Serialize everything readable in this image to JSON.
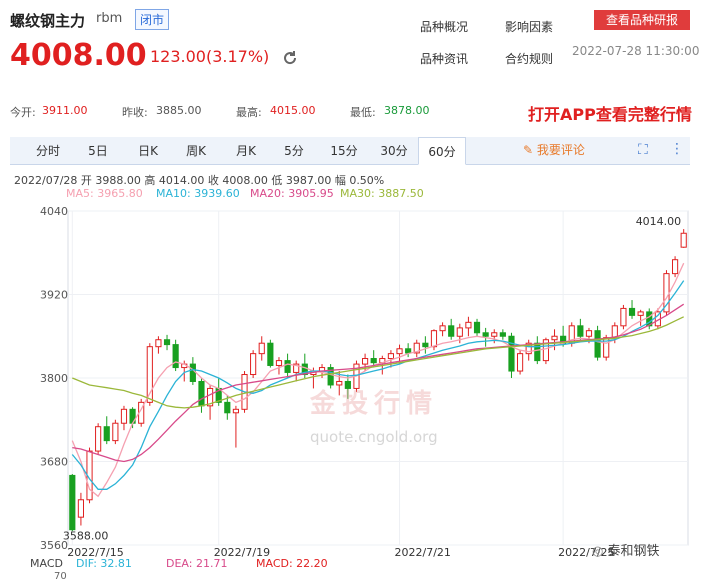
{
  "header": {
    "title": "螺纹钢主力",
    "symbol": "rbm",
    "status_badge": "闭市",
    "price": "4008.00",
    "change": "123.00(3.17%)",
    "links": [
      "品种概况",
      "影响因素",
      "品种资讯",
      "合约规则"
    ],
    "research_button": "查看品种研报",
    "timestamp": "2022-07-28 11:30:00"
  },
  "stats": {
    "open_label": "今开:",
    "open": "3911.00",
    "prev_label": "昨收:",
    "prev": "3885.00",
    "high_label": "最高:",
    "high": "4015.00",
    "low_label": "最低:",
    "low": "3878.00",
    "app_banner": "打开APP查看完整行情"
  },
  "tabs": [
    "分时",
    "5日",
    "日K",
    "周K",
    "月K",
    "5分",
    "15分",
    "30分",
    "60分"
  ],
  "active_tab": "60分",
  "comment_label": "我要评论",
  "candle_info": "2022/07/28  开 3988.00  高 4014.00  收 4008.00  低 3987.00  幅 0.50%",
  "ma": {
    "ma5": "MA5: 3965.80",
    "ma10": "MA10: 3939.60",
    "ma20": "MA20: 3905.95",
    "ma30": "MA30: 3887.50"
  },
  "macd": {
    "label": "MACD",
    "dif": "DIF: 32.81",
    "dea": "DEA: 21.71",
    "macd": "MACD: 22.20",
    "axis_top": "70"
  },
  "watermark": {
    "cn": "金投行情",
    "url": "quote.cngold.org"
  },
  "wechat": "泰和钢铁",
  "chart_data": {
    "type": "candlestick",
    "y_ticks": [
      4040,
      3920,
      3800,
      3680,
      3560
    ],
    "ylim": [
      3560,
      4040
    ],
    "x_labels": [
      "2022/7/15",
      "2022/7/19",
      "2022/7/21",
      "2022/7/25"
    ],
    "max_label": "4014.00",
    "min_label": "3588.00",
    "candles": [
      [
        3660,
        3662,
        3580,
        3582
      ],
      [
        3600,
        3635,
        3588,
        3625
      ],
      [
        3625,
        3700,
        3620,
        3695
      ],
      [
        3695,
        3735,
        3690,
        3730
      ],
      [
        3730,
        3745,
        3705,
        3710
      ],
      [
        3710,
        3740,
        3705,
        3735
      ],
      [
        3735,
        3760,
        3725,
        3755
      ],
      [
        3755,
        3758,
        3728,
        3735
      ],
      [
        3735,
        3770,
        3730,
        3765
      ],
      [
        3765,
        3850,
        3760,
        3845
      ],
      [
        3845,
        3860,
        3835,
        3855
      ],
      [
        3855,
        3862,
        3840,
        3848
      ],
      [
        3848,
        3855,
        3810,
        3815
      ],
      [
        3815,
        3825,
        3795,
        3820
      ],
      [
        3820,
        3830,
        3790,
        3795
      ],
      [
        3795,
        3800,
        3750,
        3760
      ],
      [
        3760,
        3790,
        3740,
        3785
      ],
      [
        3785,
        3800,
        3760,
        3765
      ],
      [
        3765,
        3775,
        3740,
        3750
      ],
      [
        3750,
        3760,
        3700,
        3755
      ],
      [
        3755,
        3810,
        3750,
        3805
      ],
      [
        3805,
        3840,
        3800,
        3835
      ],
      [
        3835,
        3860,
        3825,
        3850
      ],
      [
        3850,
        3855,
        3815,
        3818
      ],
      [
        3818,
        3830,
        3805,
        3825
      ],
      [
        3825,
        3835,
        3800,
        3808
      ],
      [
        3808,
        3825,
        3795,
        3820
      ],
      [
        3820,
        3835,
        3800,
        3805
      ],
      [
        3805,
        3815,
        3785,
        3810
      ],
      [
        3810,
        3820,
        3800,
        3815
      ],
      [
        3815,
        3820,
        3785,
        3790
      ],
      [
        3790,
        3810,
        3775,
        3795
      ],
      [
        3795,
        3805,
        3770,
        3785
      ],
      [
        3785,
        3825,
        3780,
        3820
      ],
      [
        3820,
        3835,
        3810,
        3828
      ],
      [
        3828,
        3840,
        3815,
        3822
      ],
      [
        3822,
        3832,
        3805,
        3828
      ],
      [
        3828,
        3840,
        3815,
        3835
      ],
      [
        3835,
        3848,
        3820,
        3842
      ],
      [
        3842,
        3850,
        3830,
        3836
      ],
      [
        3836,
        3855,
        3830,
        3850
      ],
      [
        3850,
        3860,
        3835,
        3845
      ],
      [
        3845,
        3870,
        3840,
        3868
      ],
      [
        3868,
        3880,
        3860,
        3875
      ],
      [
        3875,
        3885,
        3855,
        3860
      ],
      [
        3860,
        3878,
        3850,
        3872
      ],
      [
        3872,
        3888,
        3860,
        3880
      ],
      [
        3880,
        3885,
        3860,
        3865
      ],
      [
        3865,
        3872,
        3845,
        3860
      ],
      [
        3860,
        3870,
        3850,
        3865
      ],
      [
        3865,
        3870,
        3855,
        3860
      ],
      [
        3860,
        3865,
        3800,
        3810
      ],
      [
        3810,
        3840,
        3805,
        3835
      ],
      [
        3835,
        3855,
        3825,
        3850
      ],
      [
        3850,
        3860,
        3820,
        3825
      ],
      [
        3825,
        3858,
        3820,
        3855
      ],
      [
        3855,
        3870,
        3840,
        3860
      ],
      [
        3860,
        3875,
        3845,
        3850
      ],
      [
        3850,
        3880,
        3845,
        3875
      ],
      [
        3875,
        3885,
        3855,
        3860
      ],
      [
        3860,
        3872,
        3850,
        3868
      ],
      [
        3868,
        3875,
        3825,
        3830
      ],
      [
        3830,
        3862,
        3825,
        3858
      ],
      [
        3858,
        3880,
        3850,
        3875
      ],
      [
        3875,
        3905,
        3870,
        3900
      ],
      [
        3900,
        3912,
        3885,
        3890
      ],
      [
        3890,
        3898,
        3875,
        3895
      ],
      [
        3895,
        3900,
        3870,
        3875
      ],
      [
        3875,
        3900,
        3870,
        3895
      ],
      [
        3895,
        3955,
        3890,
        3950
      ],
      [
        3950,
        3975,
        3945,
        3970
      ],
      [
        3988,
        4014,
        3987,
        4008
      ]
    ],
    "ma_series": [
      {
        "name": "MA5",
        "color": "#f5a0b0",
        "values": [
          3710,
          3680,
          3640,
          3630,
          3650,
          3672,
          3705,
          3735,
          3755,
          3778,
          3800,
          3815,
          3823,
          3820,
          3812,
          3800,
          3790,
          3785,
          3775,
          3765,
          3770,
          3780,
          3795,
          3810,
          3815,
          3820,
          3818,
          3815,
          3810,
          3808,
          3805,
          3802,
          3800,
          3803,
          3810,
          3818,
          3822,
          3826,
          3830,
          3835,
          3838,
          3842,
          3846,
          3850,
          3852,
          3855,
          3858,
          3860,
          3858,
          3856,
          3852,
          3845,
          3840,
          3838,
          3840,
          3842,
          3846,
          3850,
          3855,
          3857,
          3856,
          3852,
          3850,
          3855,
          3865,
          3875,
          3882,
          3888,
          3898,
          3915,
          3938,
          3965
        ]
      },
      {
        "name": "MA10",
        "color": "#2bb3d6",
        "values": [
          3690,
          3675,
          3655,
          3640,
          3640,
          3648,
          3660,
          3675,
          3700,
          3730,
          3752,
          3775,
          3795,
          3808,
          3812,
          3810,
          3805,
          3800,
          3793,
          3785,
          3780,
          3778,
          3782,
          3790,
          3795,
          3800,
          3805,
          3808,
          3810,
          3810,
          3808,
          3805,
          3803,
          3804,
          3807,
          3810,
          3813,
          3817,
          3820,
          3825,
          3828,
          3832,
          3836,
          3840,
          3843,
          3846,
          3850,
          3852,
          3853,
          3854,
          3853,
          3850,
          3847,
          3845,
          3845,
          3846,
          3847,
          3848,
          3850,
          3852,
          3853,
          3853,
          3853,
          3855,
          3860,
          3867,
          3873,
          3880,
          3890,
          3905,
          3922,
          3940
        ]
      },
      {
        "name": "MA20",
        "color": "#d84a8a",
        "values": [
          3700,
          3698,
          3694,
          3690,
          3686,
          3682,
          3680,
          3683,
          3690,
          3700,
          3712,
          3725,
          3738,
          3750,
          3762,
          3770,
          3776,
          3782,
          3786,
          3790,
          3792,
          3794,
          3796,
          3798,
          3800,
          3802,
          3804,
          3806,
          3808,
          3810,
          3811,
          3812,
          3813,
          3814,
          3816,
          3818,
          3820,
          3822,
          3824,
          3826,
          3828,
          3830,
          3832,
          3834,
          3836,
          3838,
          3840,
          3842,
          3843,
          3844,
          3845,
          3846,
          3847,
          3848,
          3849,
          3850,
          3851,
          3852,
          3853,
          3854,
          3855,
          3856,
          3857,
          3859,
          3862,
          3866,
          3870,
          3876,
          3883,
          3890,
          3898,
          3906
        ]
      },
      {
        "name": "MA30",
        "color": "#9bb83a",
        "values": [
          3800,
          3795,
          3790,
          3788,
          3786,
          3784,
          3782,
          3778,
          3775,
          3770,
          3765,
          3760,
          3758,
          3757,
          3758,
          3760,
          3763,
          3767,
          3771,
          3775,
          3778,
          3781,
          3784,
          3787,
          3790,
          3793,
          3796,
          3799,
          3802,
          3804,
          3806,
          3808,
          3810,
          3812,
          3814,
          3816,
          3818,
          3820,
          3822,
          3824,
          3826,
          3828,
          3830,
          3832,
          3834,
          3836,
          3838,
          3840,
          3842,
          3843,
          3844,
          3845,
          3846,
          3847,
          3848,
          3849,
          3850,
          3851,
          3852,
          3853,
          3854,
          3855,
          3856,
          3857,
          3859,
          3861,
          3864,
          3867,
          3871,
          3876,
          3882,
          3888
        ]
      }
    ]
  }
}
